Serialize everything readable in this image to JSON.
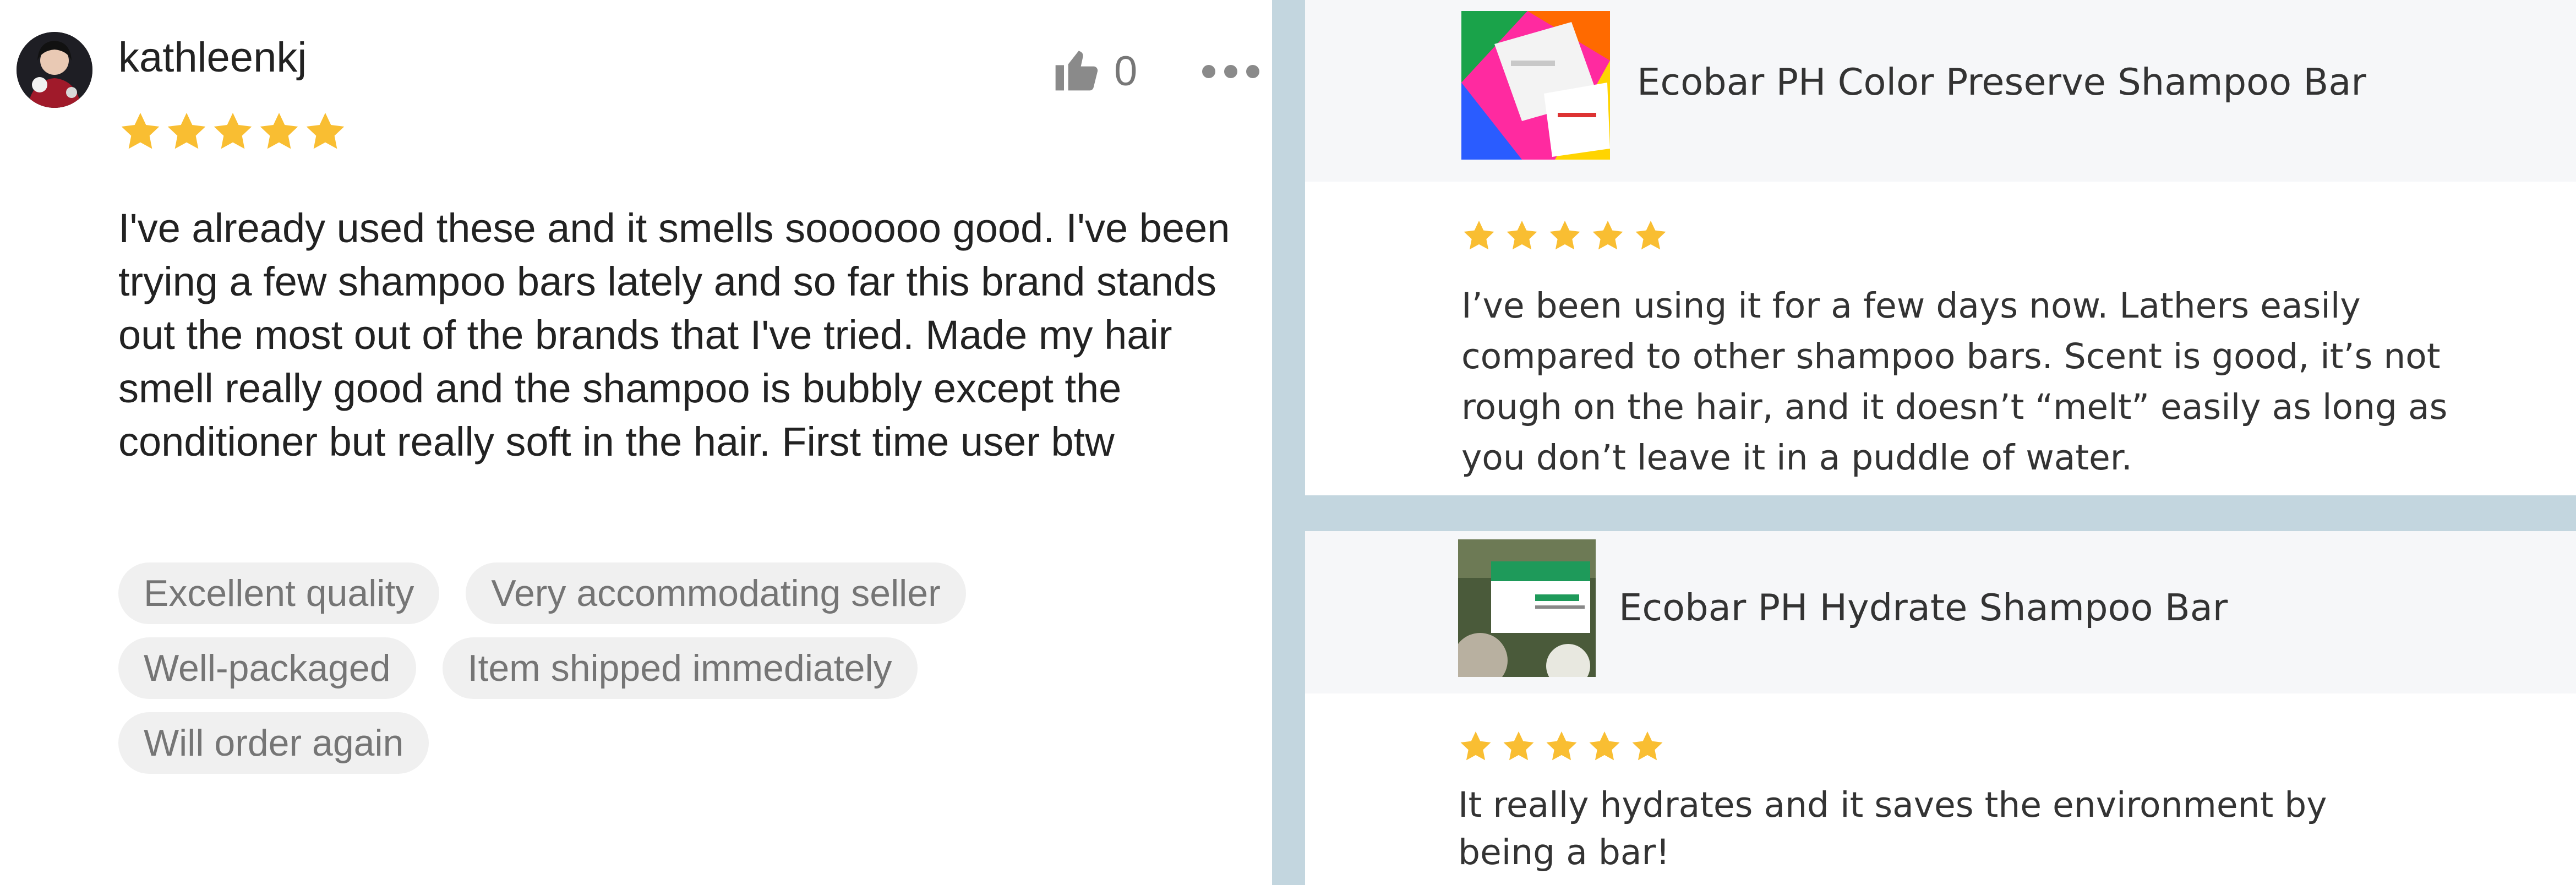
{
  "left_review": {
    "username": "kathleenkj",
    "rating": 5,
    "like_count": "0",
    "body": "I've already used these and it smells soooooo good. I've been trying a few shampoo bars lately and so far this brand stands out the most out of the brands that I've tried. Made my hair smell really good and the shampoo is bubbly except the conditioner but really soft in the hair. First time user btw",
    "tags": [
      "Excellent quality",
      "Very accommodating seller",
      "Well-packaged",
      "Item shipped immediately",
      "Will order again"
    ]
  },
  "right_reviews": [
    {
      "product_name": "Ecobar PH Color Preserve Shampoo Bar",
      "rating": 5,
      "body": "I’ve been using it for a few days now. Lathers easily compared to other shampoo bars. Scent is good, it’s not rough on the hair, and it doesn’t “melt” easily as long as you don’t leave it in a puddle of water."
    },
    {
      "product_name": "Ecobar PH Hydrate Shampoo Bar",
      "rating": 5,
      "body": "It really hydrates and it saves the environment by being a bar!"
    }
  ],
  "colors": {
    "star": "#f9be32",
    "divider": "#c3d6df",
    "tag_bg": "#f0f0f0"
  },
  "icons": [
    "avatar",
    "star-icon",
    "thumbs-up-icon",
    "more-options-icon"
  ]
}
